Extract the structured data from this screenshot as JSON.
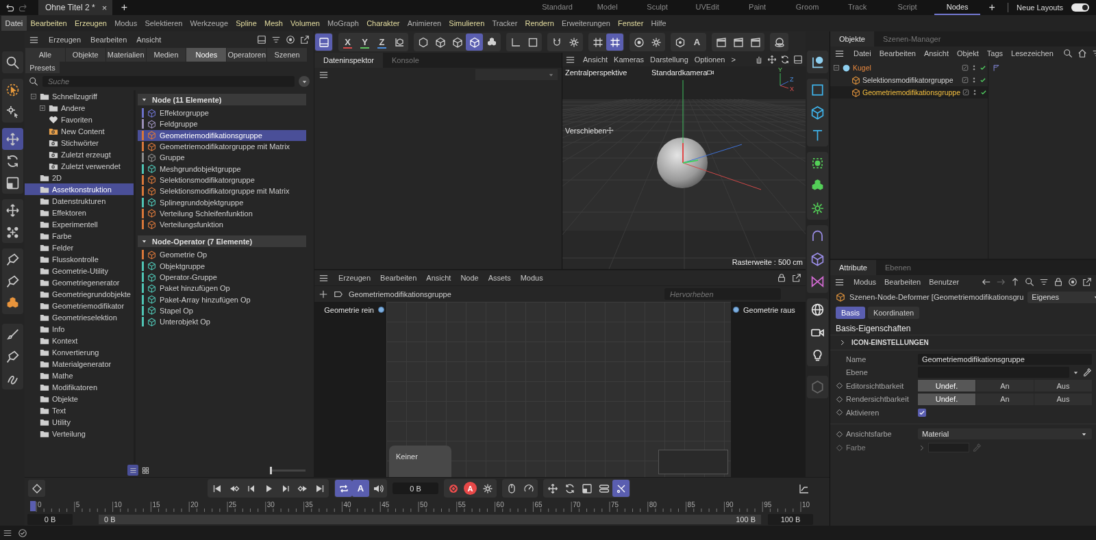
{
  "title_bar": {
    "document_tab": "Ohne Titel 2 *",
    "close": "×",
    "new_tab": "+",
    "layouts": [
      {
        "label": "Standard",
        "selected": false
      },
      {
        "label": "Model",
        "selected": false
      },
      {
        "label": "Sculpt",
        "selected": false
      },
      {
        "label": "UVEdit",
        "selected": false
      },
      {
        "label": "Paint",
        "selected": false
      },
      {
        "label": "Groom",
        "selected": false
      },
      {
        "label": "Track",
        "selected": false
      },
      {
        "label": "Script",
        "selected": false
      },
      {
        "label": "Nodes",
        "selected": true
      }
    ],
    "add_layout": "+",
    "layouts_label": "Neue Layouts",
    "layouts_toggle": true
  },
  "menu_bar": [
    {
      "label": "Datei",
      "selected": true,
      "accent": false
    },
    {
      "label": "Bearbeiten",
      "selected": false,
      "accent": true
    },
    {
      "label": "Erzeugen",
      "selected": false,
      "accent": true
    },
    {
      "label": "Modus",
      "selected": false,
      "accent": false
    },
    {
      "label": "Selektieren",
      "selected": false,
      "accent": false
    },
    {
      "label": "Werkzeuge",
      "selected": false,
      "accent": false
    },
    {
      "label": "Spline",
      "selected": false,
      "accent": true
    },
    {
      "label": "Mesh",
      "selected": false,
      "accent": true
    },
    {
      "label": "Volumen",
      "selected": false,
      "accent": true
    },
    {
      "label": "MoGraph",
      "selected": false,
      "accent": false
    },
    {
      "label": "Charakter",
      "selected": false,
      "accent": true
    },
    {
      "label": "Animieren",
      "selected": false,
      "accent": false
    },
    {
      "label": "Simulieren",
      "selected": false,
      "accent": true
    },
    {
      "label": "Tracker",
      "selected": false,
      "accent": false
    },
    {
      "label": "Rendern",
      "selected": false,
      "accent": true
    },
    {
      "label": "Erweiterungen",
      "selected": false,
      "accent": false
    },
    {
      "label": "Fenster",
      "selected": false,
      "accent": true
    },
    {
      "label": "Hilfe",
      "selected": false,
      "accent": false
    }
  ],
  "tools": [
    {
      "selected": false
    },
    {
      "selected": false
    },
    {
      "selected": false
    },
    {
      "selected": true
    },
    {
      "selected": false
    },
    {
      "selected": false
    },
    {
      "selected": false
    },
    {
      "selected": false
    },
    {
      "selected": false
    },
    {
      "selected": false
    },
    {
      "selected": false
    },
    {
      "selected": false
    },
    {
      "selected": false
    },
    {
      "selected": false
    }
  ],
  "asset_browser": {
    "menu": [
      "Erzeugen",
      "Bearbeiten",
      "Ansicht"
    ],
    "filters": [
      {
        "label": "Alle",
        "selected": false
      },
      {
        "label": "Objekte",
        "selected": false
      },
      {
        "label": "Materialien",
        "selected": false
      },
      {
        "label": "Medien",
        "selected": false
      },
      {
        "label": "Nodes",
        "selected": true
      },
      {
        "label": "Operatoren",
        "selected": false
      },
      {
        "label": "Szenen",
        "selected": false
      }
    ],
    "presets": {
      "label": "Presets",
      "selected": false
    },
    "search_placeholder": "Suche",
    "tree": [
      {
        "label": "Schnellzugriff",
        "kind": "folder",
        "expanded": true,
        "selected": false,
        "children": [
          {
            "label": "Andere",
            "kind": "folder",
            "expanded": false,
            "selected": false
          },
          {
            "label": "Favoriten",
            "kind": "heart",
            "selected": false
          },
          {
            "label": "New Content",
            "kind": "newsearch",
            "selected": false
          },
          {
            "label": "Stichwörter",
            "kind": "search",
            "selected": false
          },
          {
            "label": "Zuletzt erzeugt",
            "kind": "search",
            "selected": false
          },
          {
            "label": "Zuletzt verwendet",
            "kind": "search",
            "selected": false
          }
        ]
      },
      {
        "label": "2D",
        "kind": "folder",
        "selected": false
      },
      {
        "label": "Assetkonstruktion",
        "kind": "folder",
        "selected": true
      },
      {
        "label": "Datenstrukturen",
        "kind": "folder",
        "selected": false
      },
      {
        "label": "Effektoren",
        "kind": "folder",
        "selected": false
      },
      {
        "label": "Experimentell",
        "kind": "folder",
        "selected": false
      },
      {
        "label": "Farbe",
        "kind": "folder",
        "selected": false
      },
      {
        "label": "Felder",
        "kind": "folder",
        "selected": false
      },
      {
        "label": "Flusskontrolle",
        "kind": "folder",
        "selected": false
      },
      {
        "label": "Geometrie-Utility",
        "kind": "folder",
        "selected": false
      },
      {
        "label": "Geometriegenerator",
        "kind": "folder",
        "selected": false
      },
      {
        "label": "Geometriegrundobjekte",
        "kind": "folder",
        "selected": false
      },
      {
        "label": "Geometriemodifikator",
        "kind": "folder",
        "selected": false
      },
      {
        "label": "Geometrieselektion",
        "kind": "folder",
        "selected": false
      },
      {
        "label": "Info",
        "kind": "folder",
        "selected": false
      },
      {
        "label": "Kontext",
        "kind": "folder",
        "selected": false
      },
      {
        "label": "Konvertierung",
        "kind": "folder",
        "selected": false
      },
      {
        "label": "Materialgenerator",
        "kind": "folder",
        "selected": false
      },
      {
        "label": "Mathe",
        "kind": "folder",
        "selected": false
      },
      {
        "label": "Modifikatoren",
        "kind": "folder",
        "selected": false
      },
      {
        "label": "Objekte",
        "kind": "folder",
        "selected": false
      },
      {
        "label": "Text",
        "kind": "folder",
        "selected": false
      },
      {
        "label": "Utility",
        "kind": "folder",
        "selected": false
      },
      {
        "label": "Verteilung",
        "kind": "folder",
        "selected": false
      }
    ],
    "groups": [
      {
        "title": "Node (11 Elemente)",
        "expanded": true,
        "items": [
          {
            "label": "Effektorgruppe",
            "color": "#6b70c8",
            "selected": false
          },
          {
            "label": "Feldgruppe",
            "color": "#9a8fb8",
            "selected": false
          },
          {
            "label": "Geometriemodifikationsgruppe",
            "color": "#d8773a",
            "selected": true
          },
          {
            "label": "Geometriemodifikatorgruppe mit Matrix",
            "color": "#d8773a",
            "selected": false
          },
          {
            "label": "Gruppe",
            "color": "#8a8a8a",
            "selected": false
          },
          {
            "label": "Meshgrundobjektgruppe",
            "color": "#4fc4b4",
            "selected": false
          },
          {
            "label": "Selektionsmodifikatorgruppe",
            "color": "#d8773a",
            "selected": false
          },
          {
            "label": "Selektionsmodifikatorgruppe mit Matrix",
            "color": "#d8773a",
            "selected": false
          },
          {
            "label": "Splinegrundobjektgruppe",
            "color": "#4fc4b4",
            "selected": false
          },
          {
            "label": "Verteilung Schleifenfunktion",
            "color": "#d8773a",
            "selected": false
          },
          {
            "label": "Verteilungsfunktion",
            "color": "#d8773a",
            "selected": false
          }
        ]
      },
      {
        "title": "Node-Operator (7 Elemente)",
        "expanded": true,
        "items": [
          {
            "label": "Geometrie Op",
            "color": "#d8773a",
            "selected": false
          },
          {
            "label": "Objektgruppe",
            "color": "#4fc4b4",
            "selected": false
          },
          {
            "label": "Operator-Gruppe",
            "color": "#4fc4b4",
            "selected": false
          },
          {
            "label": "Paket hinzufügen Op",
            "color": "#4fc4b4",
            "selected": false
          },
          {
            "label": "Paket-Array hinzufügen Op",
            "color": "#4fc4b4",
            "selected": false
          },
          {
            "label": "Stapel Op",
            "color": "#4fc4b4",
            "selected": false
          },
          {
            "label": "Unterobjekt Op",
            "color": "#4fc4b4",
            "selected": false
          }
        ]
      }
    ],
    "view_modes": [
      {
        "selected": true
      },
      {
        "selected": false
      }
    ],
    "icon_size": {
      "level": 0
    }
  },
  "toolbar": [
    {
      "buttons": [
        {
          "selected": true
        }
      ]
    },
    {
      "buttons": [
        {
          "label": "X",
          "color": "#d94a4a",
          "selected": false
        },
        {
          "label": "Y",
          "color": "#5fc55f",
          "selected": false
        },
        {
          "label": "Z",
          "color": "#4a8ee0",
          "selected": false
        },
        {
          "selected": false
        }
      ]
    },
    {
      "buttons": [
        {
          "selected": false
        },
        {
          "selected": false
        },
        {
          "selected": false
        },
        {
          "selected": true
        },
        {
          "selected": false
        }
      ]
    },
    {
      "buttons": [
        {
          "selected": false
        },
        {
          "selected": false
        }
      ]
    },
    {
      "buttons": [
        {
          "selected": false
        },
        {
          "selected": false
        }
      ]
    },
    {
      "buttons": [
        {
          "selected": false
        },
        {
          "selected": true
        }
      ]
    },
    {
      "buttons": [
        {
          "selected": false
        },
        {
          "selected": false
        }
      ]
    },
    {
      "buttons": [
        {
          "selected": false
        },
        {
          "label": "A",
          "selected": false
        }
      ]
    },
    {
      "buttons": [
        {
          "selected": false
        },
        {
          "selected": false
        },
        {
          "selected": false
        }
      ]
    },
    {
      "buttons": [
        {
          "selected": false
        }
      ]
    }
  ],
  "inspector": {
    "tabs": [
      {
        "label": "Dateninspektor",
        "selected": true
      },
      {
        "label": "Konsole",
        "selected": false
      }
    ]
  },
  "viewport": {
    "menu": [
      "Ansicht",
      "Kameras",
      "Darstellung",
      "Optionen",
      ">"
    ],
    "projection": "Zentralperspektive",
    "camera": "Standardkamera",
    "gizmo": [
      "Y",
      "Z",
      "X"
    ],
    "tool": "Verschieben",
    "grid_size": "Rasterweite : 500 cm"
  },
  "node_editor": {
    "menu": [
      "Erzeugen",
      "Bearbeiten",
      "Ansicht",
      "Node",
      "Assets",
      "Modus"
    ],
    "path": "Geometriemodifikationsgruppe",
    "search_placeholder": "Hervorheben",
    "input_port": "Geometrie rein",
    "output_port": "Geometrie raus",
    "group": "Keiner"
  },
  "vtools": [
    {
      "disabled": false
    },
    {
      "disabled": false
    },
    {
      "disabled": false
    },
    {
      "disabled": false
    },
    {
      "disabled": false
    },
    {
      "disabled": false
    },
    {
      "disabled": false
    },
    {
      "disabled": false
    },
    {
      "disabled": false
    },
    {
      "disabled": false
    },
    {
      "disabled": false
    },
    {
      "disabled": false
    },
    {
      "disabled": false
    },
    {
      "disabled": true
    }
  ],
  "timeline": {
    "transport": [
      {
        "buttons": [
          {
            "selected": false
          },
          {
            "selected": false
          },
          {
            "selected": false
          },
          {
            "selected": false
          },
          {
            "selected": false
          },
          {
            "selected": false
          },
          {
            "selected": false
          }
        ]
      },
      {
        "buttons": [
          {
            "selected": true
          },
          {
            "label": "A",
            "selected": true
          },
          {
            "selected": false
          }
        ]
      }
    ],
    "frame": "0 B",
    "record": [
      {
        "buttons": [
          {
            "selected": false
          },
          {
            "label": "A",
            "selected": false
          },
          {
            "selected": false
          }
        ]
      },
      {
        "buttons": [
          {
            "selected": false
          },
          {
            "selected": false
          }
        ]
      },
      {
        "buttons": [
          {
            "selected": false
          },
          {
            "selected": false
          },
          {
            "selected": false
          },
          {
            "selected": false
          },
          {
            "selected": true
          }
        ]
      }
    ],
    "ruler": [
      "0",
      "5",
      "10",
      "15",
      "20",
      "25",
      "30",
      "35",
      "40",
      "45",
      "50",
      "55",
      "60",
      "65",
      "70",
      "75",
      "80",
      "85",
      "90",
      "95",
      "10"
    ],
    "start": "0 B",
    "range_start": "0 B",
    "range_end": "100 B",
    "end": "100 B"
  },
  "objects": {
    "tabs": [
      {
        "label": "Objekte",
        "selected": true
      },
      {
        "label": "Szenen-Manager",
        "selected": false
      }
    ],
    "menu": [
      "Datei",
      "Bearbeiten",
      "Ansicht",
      "Objekt",
      "Tags",
      "Lesezeichen"
    ],
    "tree": [
      {
        "label": "Kugel",
        "kind": "sphere",
        "expanded": true,
        "selected": false,
        "parent_of_selection": true,
        "enabled": true,
        "tag": true,
        "children": [
          {
            "label": "Selektionsmodifikatorgruppe",
            "kind": "node",
            "selected": false,
            "enabled": true,
            "tag": false
          },
          {
            "label": "Geometriemodifikationsgruppe",
            "kind": "node",
            "selected": true,
            "enabled": true,
            "tag": false
          }
        ]
      }
    ]
  },
  "attributes": {
    "tabs": [
      {
        "label": "Attribute",
        "selected": true
      },
      {
        "label": "Ebenen",
        "selected": false
      }
    ],
    "menu": [
      "Modus",
      "Bearbeiten",
      "Benutzer"
    ],
    "title": "Szenen-Node-Deformer [Geometriemodifikationsgru",
    "mode": "Eigenes",
    "subtabs": [
      {
        "label": "Basis",
        "selected": true
      },
      {
        "label": "Koordinaten",
        "selected": false
      }
    ],
    "heading": "Basis-Eigenschaften",
    "section": {
      "label": "ICON-EINSTELLUNGEN",
      "expanded": false
    },
    "properties": [
      {
        "kind": "text",
        "label": "Name",
        "value": "Geometriemodifikationsgruppe",
        "animatable": false,
        "disabled": false
      },
      {
        "kind": "layer",
        "label": "Ebene",
        "animatable": false,
        "disabled": false
      },
      {
        "kind": "segmented",
        "label": "Editorsichtbarkeit",
        "options": [
          {
            "label": "Undef.",
            "selected": true
          },
          {
            "label": "An",
            "selected": false
          },
          {
            "label": "Aus",
            "selected": false
          }
        ],
        "animatable": true,
        "disabled": false
      },
      {
        "kind": "segmented",
        "label": "Rendersichtbarkeit",
        "options": [
          {
            "label": "Undef.",
            "selected": true
          },
          {
            "label": "An",
            "selected": false
          },
          {
            "label": "Aus",
            "selected": false
          }
        ],
        "animatable": true,
        "disabled": false
      },
      {
        "kind": "checkbox",
        "label": "Aktivieren",
        "checked": true,
        "animatable": true,
        "disabled": false
      },
      {
        "kind": "dropdown",
        "label": "Ansichtsfarbe",
        "value": "Material",
        "animatable": true,
        "disabled": false
      },
      {
        "kind": "color",
        "label": "Farbe",
        "animatable": true,
        "disabled": true
      }
    ]
  }
}
